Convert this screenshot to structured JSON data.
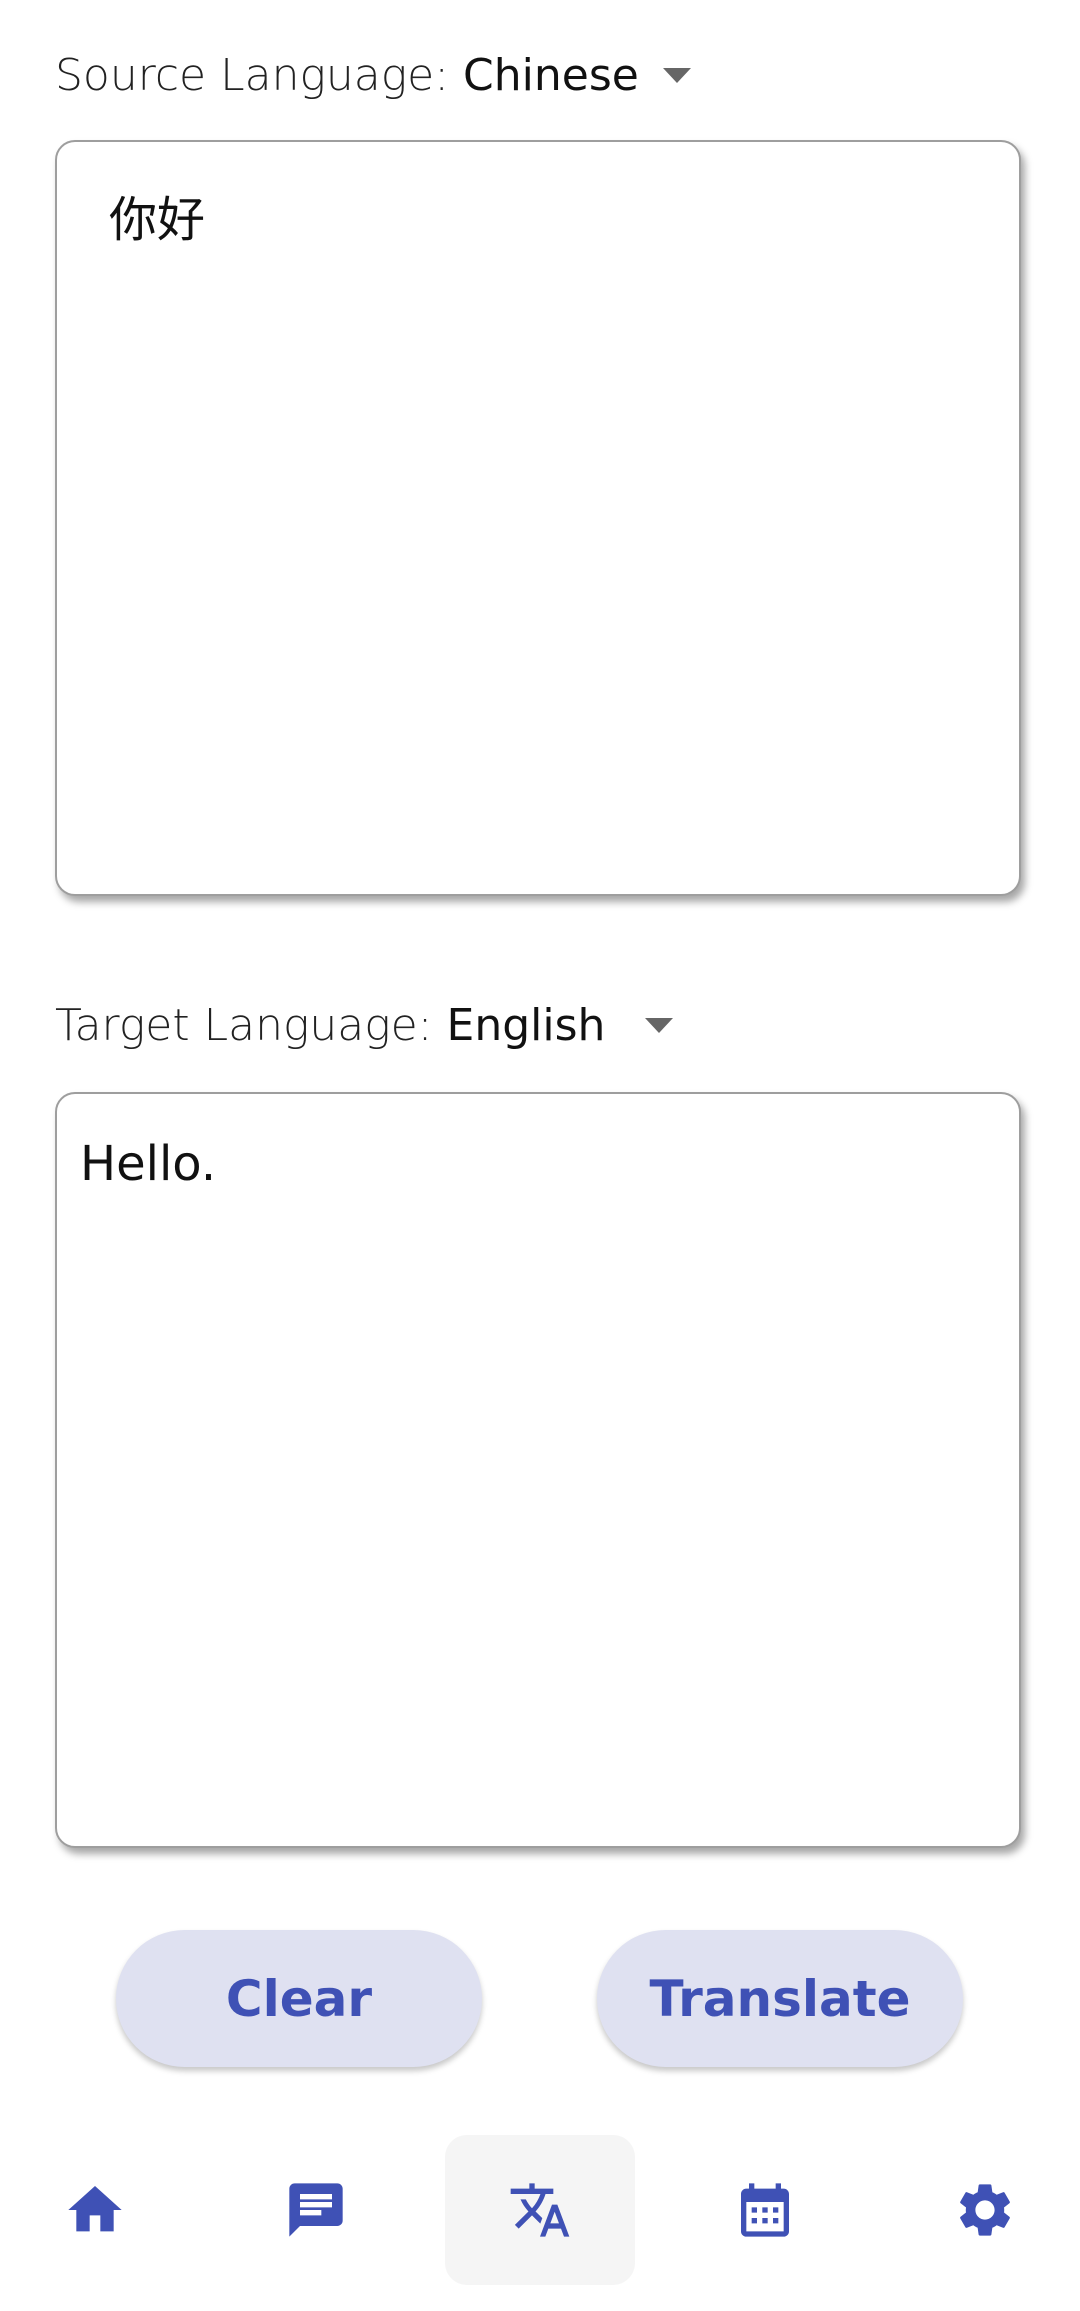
{
  "source": {
    "label_prefix": "Source Language:",
    "language": "Chinese",
    "text": "你好"
  },
  "target": {
    "label_prefix": "Target Language:",
    "language": "English",
    "text": "Hello."
  },
  "buttons": {
    "clear": "Clear",
    "translate": "Translate"
  },
  "nav": {
    "items": [
      {
        "icon": "home-icon"
      },
      {
        "icon": "chat-icon"
      },
      {
        "icon": "translate-icon",
        "active": true
      },
      {
        "icon": "calendar-icon"
      },
      {
        "icon": "settings-icon"
      }
    ]
  },
  "colors": {
    "accent": "#3f51b5",
    "button_bg": "#dfe1f1",
    "active_nav_bg": "#f5f5f5"
  }
}
